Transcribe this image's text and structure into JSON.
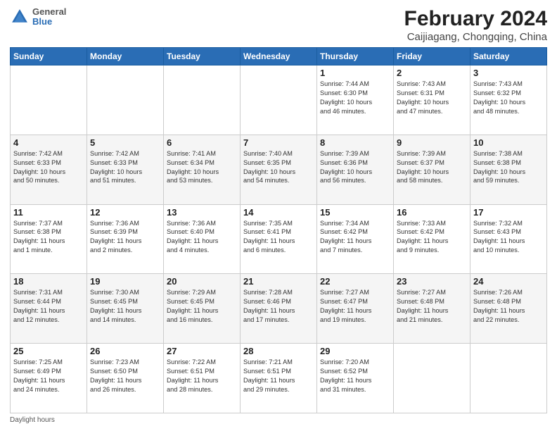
{
  "header": {
    "logo": {
      "general": "General",
      "blue": "Blue"
    },
    "title": "February 2024",
    "subtitle": "Caijiagang, Chongqing, China"
  },
  "days_of_week": [
    "Sunday",
    "Monday",
    "Tuesday",
    "Wednesday",
    "Thursday",
    "Friday",
    "Saturday"
  ],
  "weeks": [
    [
      {
        "day": "",
        "info": ""
      },
      {
        "day": "",
        "info": ""
      },
      {
        "day": "",
        "info": ""
      },
      {
        "day": "",
        "info": ""
      },
      {
        "day": "1",
        "info": "Sunrise: 7:44 AM\nSunset: 6:30 PM\nDaylight: 10 hours\nand 46 minutes."
      },
      {
        "day": "2",
        "info": "Sunrise: 7:43 AM\nSunset: 6:31 PM\nDaylight: 10 hours\nand 47 minutes."
      },
      {
        "day": "3",
        "info": "Sunrise: 7:43 AM\nSunset: 6:32 PM\nDaylight: 10 hours\nand 48 minutes."
      }
    ],
    [
      {
        "day": "4",
        "info": "Sunrise: 7:42 AM\nSunset: 6:33 PM\nDaylight: 10 hours\nand 50 minutes."
      },
      {
        "day": "5",
        "info": "Sunrise: 7:42 AM\nSunset: 6:33 PM\nDaylight: 10 hours\nand 51 minutes."
      },
      {
        "day": "6",
        "info": "Sunrise: 7:41 AM\nSunset: 6:34 PM\nDaylight: 10 hours\nand 53 minutes."
      },
      {
        "day": "7",
        "info": "Sunrise: 7:40 AM\nSunset: 6:35 PM\nDaylight: 10 hours\nand 54 minutes."
      },
      {
        "day": "8",
        "info": "Sunrise: 7:39 AM\nSunset: 6:36 PM\nDaylight: 10 hours\nand 56 minutes."
      },
      {
        "day": "9",
        "info": "Sunrise: 7:39 AM\nSunset: 6:37 PM\nDaylight: 10 hours\nand 58 minutes."
      },
      {
        "day": "10",
        "info": "Sunrise: 7:38 AM\nSunset: 6:38 PM\nDaylight: 10 hours\nand 59 minutes."
      }
    ],
    [
      {
        "day": "11",
        "info": "Sunrise: 7:37 AM\nSunset: 6:38 PM\nDaylight: 11 hours\nand 1 minute."
      },
      {
        "day": "12",
        "info": "Sunrise: 7:36 AM\nSunset: 6:39 PM\nDaylight: 11 hours\nand 2 minutes."
      },
      {
        "day": "13",
        "info": "Sunrise: 7:36 AM\nSunset: 6:40 PM\nDaylight: 11 hours\nand 4 minutes."
      },
      {
        "day": "14",
        "info": "Sunrise: 7:35 AM\nSunset: 6:41 PM\nDaylight: 11 hours\nand 6 minutes."
      },
      {
        "day": "15",
        "info": "Sunrise: 7:34 AM\nSunset: 6:42 PM\nDaylight: 11 hours\nand 7 minutes."
      },
      {
        "day": "16",
        "info": "Sunrise: 7:33 AM\nSunset: 6:42 PM\nDaylight: 11 hours\nand 9 minutes."
      },
      {
        "day": "17",
        "info": "Sunrise: 7:32 AM\nSunset: 6:43 PM\nDaylight: 11 hours\nand 10 minutes."
      }
    ],
    [
      {
        "day": "18",
        "info": "Sunrise: 7:31 AM\nSunset: 6:44 PM\nDaylight: 11 hours\nand 12 minutes."
      },
      {
        "day": "19",
        "info": "Sunrise: 7:30 AM\nSunset: 6:45 PM\nDaylight: 11 hours\nand 14 minutes."
      },
      {
        "day": "20",
        "info": "Sunrise: 7:29 AM\nSunset: 6:45 PM\nDaylight: 11 hours\nand 16 minutes."
      },
      {
        "day": "21",
        "info": "Sunrise: 7:28 AM\nSunset: 6:46 PM\nDaylight: 11 hours\nand 17 minutes."
      },
      {
        "day": "22",
        "info": "Sunrise: 7:27 AM\nSunset: 6:47 PM\nDaylight: 11 hours\nand 19 minutes."
      },
      {
        "day": "23",
        "info": "Sunrise: 7:27 AM\nSunset: 6:48 PM\nDaylight: 11 hours\nand 21 minutes."
      },
      {
        "day": "24",
        "info": "Sunrise: 7:26 AM\nSunset: 6:48 PM\nDaylight: 11 hours\nand 22 minutes."
      }
    ],
    [
      {
        "day": "25",
        "info": "Sunrise: 7:25 AM\nSunset: 6:49 PM\nDaylight: 11 hours\nand 24 minutes."
      },
      {
        "day": "26",
        "info": "Sunrise: 7:23 AM\nSunset: 6:50 PM\nDaylight: 11 hours\nand 26 minutes."
      },
      {
        "day": "27",
        "info": "Sunrise: 7:22 AM\nSunset: 6:51 PM\nDaylight: 11 hours\nand 28 minutes."
      },
      {
        "day": "28",
        "info": "Sunrise: 7:21 AM\nSunset: 6:51 PM\nDaylight: 11 hours\nand 29 minutes."
      },
      {
        "day": "29",
        "info": "Sunrise: 7:20 AM\nSunset: 6:52 PM\nDaylight: 11 hours\nand 31 minutes."
      },
      {
        "day": "",
        "info": ""
      },
      {
        "day": "",
        "info": ""
      }
    ]
  ],
  "footer": {
    "daylight_hours_label": "Daylight hours"
  }
}
